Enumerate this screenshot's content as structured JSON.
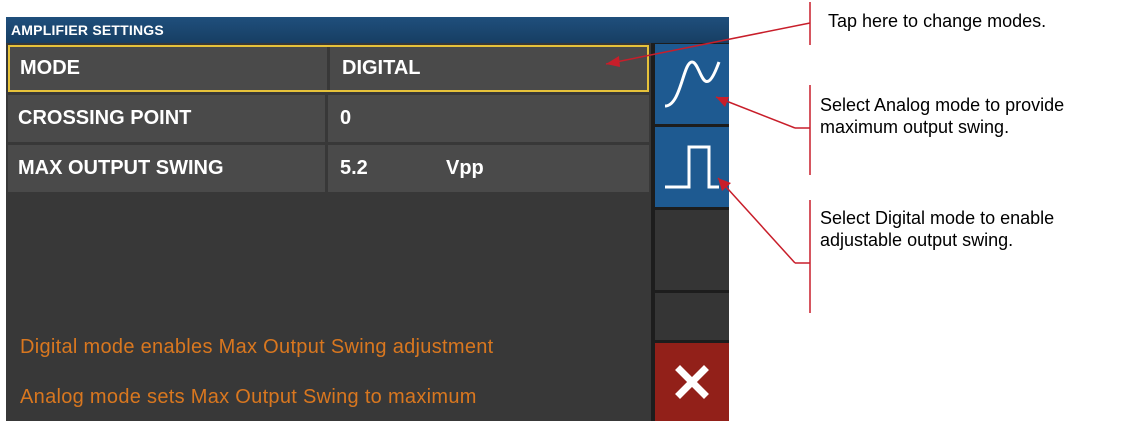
{
  "title_bar": {
    "title": "AMPLIFIER SETTINGS"
  },
  "settings": [
    {
      "label": "MODE",
      "value": "DIGITAL",
      "unit": ""
    },
    {
      "label": "CROSSING POINT",
      "value": "0",
      "unit": ""
    },
    {
      "label": "MAX OUTPUT SWING",
      "value": "5.2",
      "unit": "Vpp"
    }
  ],
  "info_text": {
    "line1": "Digital mode enables Max Output Swing adjustment",
    "line2": "Analog mode sets Max Output Swing to maximum"
  },
  "side_buttons": {
    "analog_icon": "sine-wave-icon",
    "digital_icon": "square-wave-icon",
    "close_icon": "close-icon"
  },
  "annotations": {
    "mode_tip": "Tap here to change modes.",
    "analog_tip": "Select Analog mode to provide maximum output swing.",
    "digital_tip": "Select Digital mode to enable adjustable output swing."
  },
  "colors": {
    "title_bar": "#1f4f7c",
    "panel": "#383838",
    "row": "#4a4a4a",
    "highlight_border": "#e6c23a",
    "info_text": "#d9771f",
    "mode_button": "#1e5a91",
    "close_button": "#922019",
    "annotation_line": "#c81e2a"
  }
}
